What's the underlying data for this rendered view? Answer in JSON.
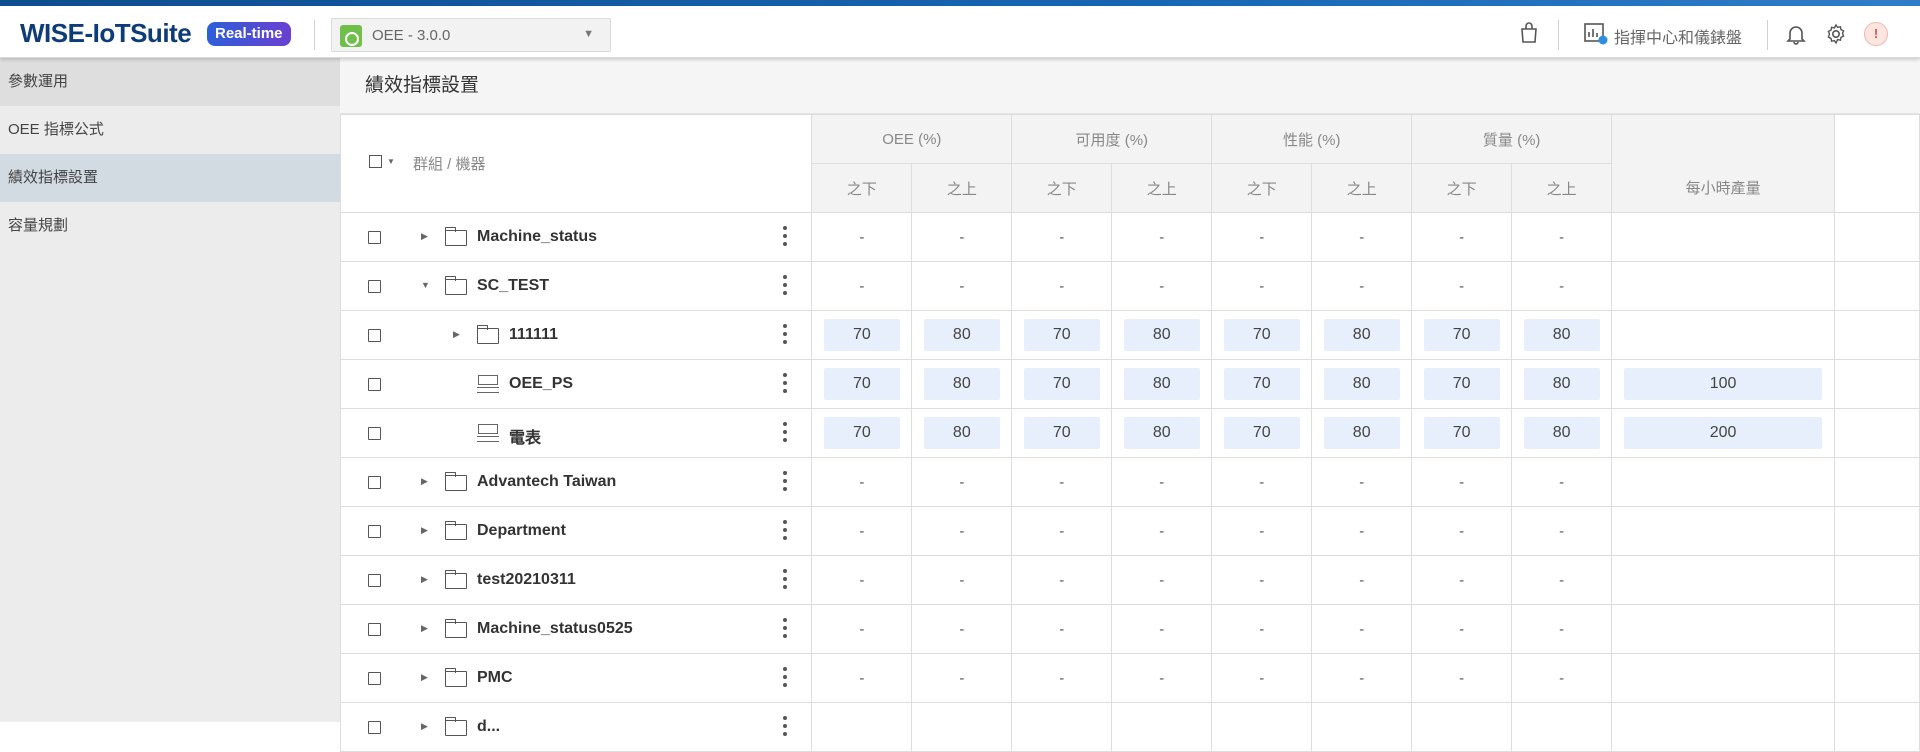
{
  "header": {
    "logo": "WISE-IoTSuite",
    "badge": "Real-time",
    "app_selector": {
      "label": "OEE - 3.0.0"
    },
    "command_center": "指揮中心和儀錶盤",
    "avatar_text": "!"
  },
  "sidebar": {
    "items": [
      {
        "label": "參數運用",
        "state": "dim"
      },
      {
        "label": "OEE 指標公式",
        "state": "normal"
      },
      {
        "label": "績效指標設置",
        "state": "active"
      },
      {
        "label": "容量規劃",
        "state": "normal"
      }
    ]
  },
  "page": {
    "title": "績效指標設置",
    "columns": {
      "name_header": "群組 / 機器",
      "groups": [
        "OEE (%)",
        "可用度 (%)",
        "性能 (%)",
        "質量 (%)"
      ],
      "below": "之下",
      "above": "之上",
      "hourly": "每小時產量"
    },
    "rows": [
      {
        "name": "Machine_status",
        "type": "folder",
        "level": 0,
        "expander": "collapsed",
        "values": [
          "-",
          "-",
          "-",
          "-",
          "-",
          "-",
          "-",
          "-"
        ],
        "hourly": "",
        "editable": false
      },
      {
        "name": "SC_TEST",
        "type": "folder",
        "level": 0,
        "expander": "expanded",
        "values": [
          "-",
          "-",
          "-",
          "-",
          "-",
          "-",
          "-",
          "-"
        ],
        "hourly": "",
        "editable": false
      },
      {
        "name": "111111",
        "type": "folder",
        "level": 1,
        "expander": "collapsed",
        "values": [
          "70",
          "80",
          "70",
          "80",
          "70",
          "80",
          "70",
          "80"
        ],
        "hourly": "",
        "editable": true
      },
      {
        "name": "OEE_PS",
        "type": "machine",
        "level": 1,
        "expander": "none",
        "values": [
          "70",
          "80",
          "70",
          "80",
          "70",
          "80",
          "70",
          "80"
        ],
        "hourly": "100",
        "editable": true
      },
      {
        "name": "電表",
        "type": "machine",
        "level": 1,
        "expander": "none",
        "values": [
          "70",
          "80",
          "70",
          "80",
          "70",
          "80",
          "70",
          "80"
        ],
        "hourly": "200",
        "editable": true
      },
      {
        "name": "Advantech Taiwan",
        "type": "folder",
        "level": 0,
        "expander": "collapsed",
        "values": [
          "-",
          "-",
          "-",
          "-",
          "-",
          "-",
          "-",
          "-"
        ],
        "hourly": "",
        "editable": false
      },
      {
        "name": "Department",
        "type": "folder",
        "level": 0,
        "expander": "collapsed",
        "values": [
          "-",
          "-",
          "-",
          "-",
          "-",
          "-",
          "-",
          "-"
        ],
        "hourly": "",
        "editable": false
      },
      {
        "name": "test20210311",
        "type": "folder",
        "level": 0,
        "expander": "collapsed",
        "values": [
          "-",
          "-",
          "-",
          "-",
          "-",
          "-",
          "-",
          "-"
        ],
        "hourly": "",
        "editable": false
      },
      {
        "name": "Machine_status0525",
        "type": "folder",
        "level": 0,
        "expander": "collapsed",
        "values": [
          "-",
          "-",
          "-",
          "-",
          "-",
          "-",
          "-",
          "-"
        ],
        "hourly": "",
        "editable": false
      },
      {
        "name": "PMC",
        "type": "folder",
        "level": 0,
        "expander": "collapsed",
        "values": [
          "-",
          "-",
          "-",
          "-",
          "-",
          "-",
          "-",
          "-"
        ],
        "hourly": "",
        "editable": false
      },
      {
        "name": "d...",
        "type": "folder",
        "level": 0,
        "expander": "collapsed",
        "values": [
          "",
          "",
          "",
          "",
          "",
          "",
          "",
          ""
        ],
        "hourly": "",
        "editable": false
      }
    ]
  },
  "colors": {
    "accent": "#0d3c78",
    "input_bg": "#e6effb",
    "sidebar_active": "#d2dae2"
  },
  "icons": [
    "shopping-bag-icon",
    "dashboard-icon",
    "bell-icon",
    "gear-icon",
    "folder-icon",
    "machine-icon",
    "kebab-menu-icon"
  ]
}
